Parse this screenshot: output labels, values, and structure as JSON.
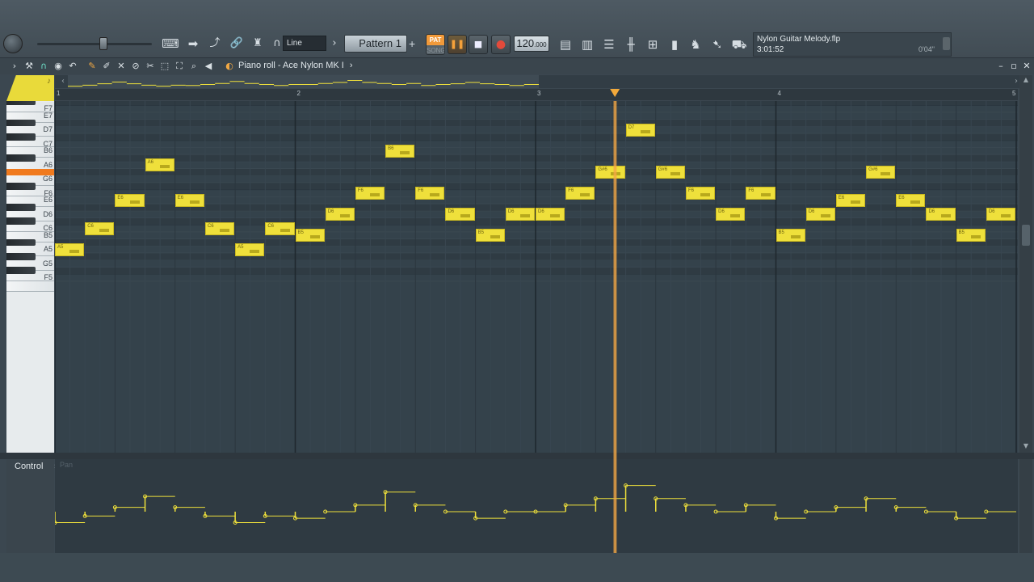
{
  "toolbar": {
    "snap": "Line",
    "pattern": "Pattern 1",
    "pattern_add": "+",
    "pat_label": "PAT",
    "song_label": "SONG",
    "tempo_main": "120",
    "tempo_frac": ".000",
    "icons": [
      "piano-keys-icon",
      "arrow-right-icon",
      "pitch-bend-icon",
      "link-icon",
      "metronome-icon",
      "headphones-icon"
    ],
    "right_icons": [
      "playlist-icon",
      "piano-roll-icon",
      "channel-rack-icon",
      "mixer-icon",
      "browser-icon",
      "clipboard-icon",
      "plugin-picker-icon",
      "help-icon",
      "store-icon"
    ]
  },
  "song": {
    "title": "Nylon Guitar Melody.flp",
    "time": "3:01:52",
    "length": "0'04\""
  },
  "piano_roll": {
    "title": "Piano roll - Ace Nylon MK I",
    "title_arrow": "›",
    "tools": [
      "menu-arrow-icon",
      "wrench-icon",
      "magnet-icon",
      "record-icon",
      "undo-icon",
      "pencil-icon",
      "brush-icon",
      "delete-icon",
      "mute-icon",
      "slice-icon",
      "select-icon",
      "zoom-icon",
      "playback-icon"
    ]
  },
  "ruler": {
    "bars": [
      "1",
      "2",
      "3",
      "4",
      "5"
    ]
  },
  "keyboard": {
    "labels": [
      "F7",
      "E7",
      "D7",
      "C7",
      "B6",
      "A6",
      "G6",
      "F6",
      "E6",
      "D6",
      "C6",
      "B5",
      "A5",
      "G5",
      "F5"
    ],
    "active_key": "G#6"
  },
  "notes": [
    {
      "pitch": "A5",
      "start": 0.0,
      "length": 0.125
    },
    {
      "pitch": "C6",
      "start": 0.125,
      "length": 0.125
    },
    {
      "pitch": "E6",
      "start": 0.25,
      "length": 0.125
    },
    {
      "pitch": "A6",
      "start": 0.375,
      "length": 0.125
    },
    {
      "pitch": "E6",
      "start": 0.5,
      "length": 0.125
    },
    {
      "pitch": "C6",
      "start": 0.625,
      "length": 0.125
    },
    {
      "pitch": "A5",
      "start": 0.75,
      "length": 0.125
    },
    {
      "pitch": "C6",
      "start": 0.875,
      "length": 0.125
    },
    {
      "pitch": "B5",
      "start": 1.0,
      "length": 0.125
    },
    {
      "pitch": "D6",
      "start": 1.125,
      "length": 0.125
    },
    {
      "pitch": "F6",
      "start": 1.25,
      "length": 0.125
    },
    {
      "pitch": "B6",
      "start": 1.375,
      "length": 0.125
    },
    {
      "pitch": "F6",
      "start": 1.5,
      "length": 0.125
    },
    {
      "pitch": "D6",
      "start": 1.625,
      "length": 0.125
    },
    {
      "pitch": "B5",
      "start": 1.75,
      "length": 0.125
    },
    {
      "pitch": "D6",
      "start": 1.875,
      "length": 0.125
    },
    {
      "pitch": "D6",
      "start": 2.0,
      "length": 0.125
    },
    {
      "pitch": "F6",
      "start": 2.125,
      "length": 0.125
    },
    {
      "pitch": "G#6",
      "start": 2.25,
      "length": 0.125
    },
    {
      "pitch": "D7",
      "start": 2.375,
      "length": 0.125
    },
    {
      "pitch": "G#6",
      "start": 2.5,
      "length": 0.125
    },
    {
      "pitch": "F6",
      "start": 2.625,
      "length": 0.125
    },
    {
      "pitch": "D6",
      "start": 2.75,
      "length": 0.125
    },
    {
      "pitch": "F6",
      "start": 2.875,
      "length": 0.125
    },
    {
      "pitch": "B5",
      "start": 3.0,
      "length": 0.125
    },
    {
      "pitch": "D6",
      "start": 3.125,
      "length": 0.125
    },
    {
      "pitch": "E6",
      "start": 3.25,
      "length": 0.125
    },
    {
      "pitch": "G#6",
      "start": 3.375,
      "length": 0.125
    },
    {
      "pitch": "E6",
      "start": 3.5,
      "length": 0.125
    },
    {
      "pitch": "D6",
      "start": 3.625,
      "length": 0.125
    },
    {
      "pitch": "B5",
      "start": 3.75,
      "length": 0.125
    },
    {
      "pitch": "D6",
      "start": 3.875,
      "length": 0.125
    }
  ],
  "playhead_bar": 2.33,
  "control": {
    "label": "Control",
    "arrow": "›",
    "sub": "Pan"
  },
  "colors": {
    "note": "#efe03b",
    "accent": "#f2a93b",
    "active_key": "#f07a1e",
    "grid_bg": "#34424b"
  }
}
